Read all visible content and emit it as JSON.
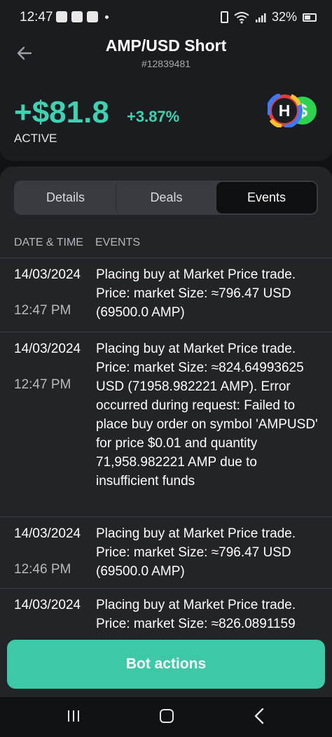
{
  "status_bar": {
    "time": "12:47",
    "battery": "32%"
  },
  "header": {
    "title": "AMP/USD Short",
    "subtitle": "#12839481",
    "profit": "+$81.8",
    "profit_percent": "+3.87%",
    "status": "ACTIVE",
    "logo_letter": "H",
    "accent_color": "#3dd3b2"
  },
  "tabs": [
    {
      "label": "Details",
      "active": false
    },
    {
      "label": "Deals",
      "active": false
    },
    {
      "label": "Events",
      "active": true
    }
  ],
  "table": {
    "columns": [
      "DATE & TIME",
      "EVENTS"
    ],
    "rows": [
      {
        "date": "14/03/2024",
        "time": "12:47 PM",
        "event": "Placing buy at Market Price trade. Price: market Size: ≈796.47 USD (69500.0 AMP)"
      },
      {
        "date": "14/03/2024",
        "time": "12:47 PM",
        "event": "Placing buy at Market Price trade. Price: market Size: ≈824.64993625 USD (71958.982221 AMP). Error occurred during request: Failed to place buy order on symbol 'AMPUSD' for price $0.01 and quantity 71,958.982221 AMP due to insufficient funds"
      },
      {
        "date": "14/03/2024",
        "time": "12:46 PM",
        "event": "Placing buy at Market Price trade. Price: market Size: ≈796.47 USD (69500.0 AMP)"
      },
      {
        "date": "14/03/2024",
        "time": "",
        "event": "Placing buy at Market Price trade. Price: market Size: ≈826.0891159"
      }
    ]
  },
  "bot_actions_label": "Bot actions"
}
